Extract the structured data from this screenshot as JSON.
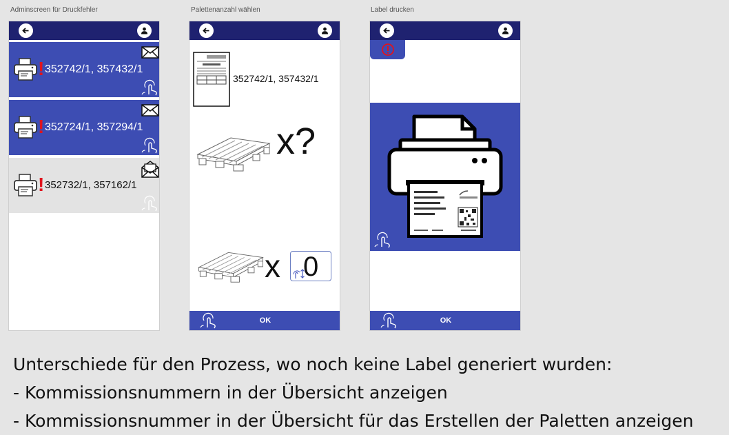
{
  "screens": [
    {
      "caption": "Adminscreen für Druckfehler"
    },
    {
      "caption": "Palettenanzahl wählen"
    },
    {
      "caption": "Label drucken"
    }
  ],
  "colors": {
    "topbar": "#1f2270",
    "accent": "#3d4db3",
    "alert": "#e0141e",
    "background": "#e5e5e5"
  },
  "admin_screen": {
    "jobs": [
      {
        "numbers": "352742/1, 357432/1",
        "status": "unread",
        "mail_icon": "envelope-icon"
      },
      {
        "numbers": "352724/1, 357294/1",
        "status": "unread",
        "mail_icon": "envelope-icon"
      },
      {
        "numbers": "352732/1, 357162/1",
        "status": "read",
        "mail_icon": "open-envelope-icon"
      }
    ],
    "alert_mark": "!"
  },
  "pallet_screen": {
    "ticket_numbers": "352742/1, 357432/1",
    "question_multiplier": "x?",
    "multiplier": "x",
    "quantity": "0",
    "ok_label": "OK"
  },
  "label_screen": {
    "ok_label": "OK"
  },
  "notes": {
    "line1": "Unterschiede für den Prozess, wo noch keine Label generiert wurden:",
    "line2": "- Kommissionsnummern in der Übersicht anzeigen",
    "line3": "- Kommissionsnummer in der Übersicht für das Erstellen der Paletten anzeigen"
  }
}
